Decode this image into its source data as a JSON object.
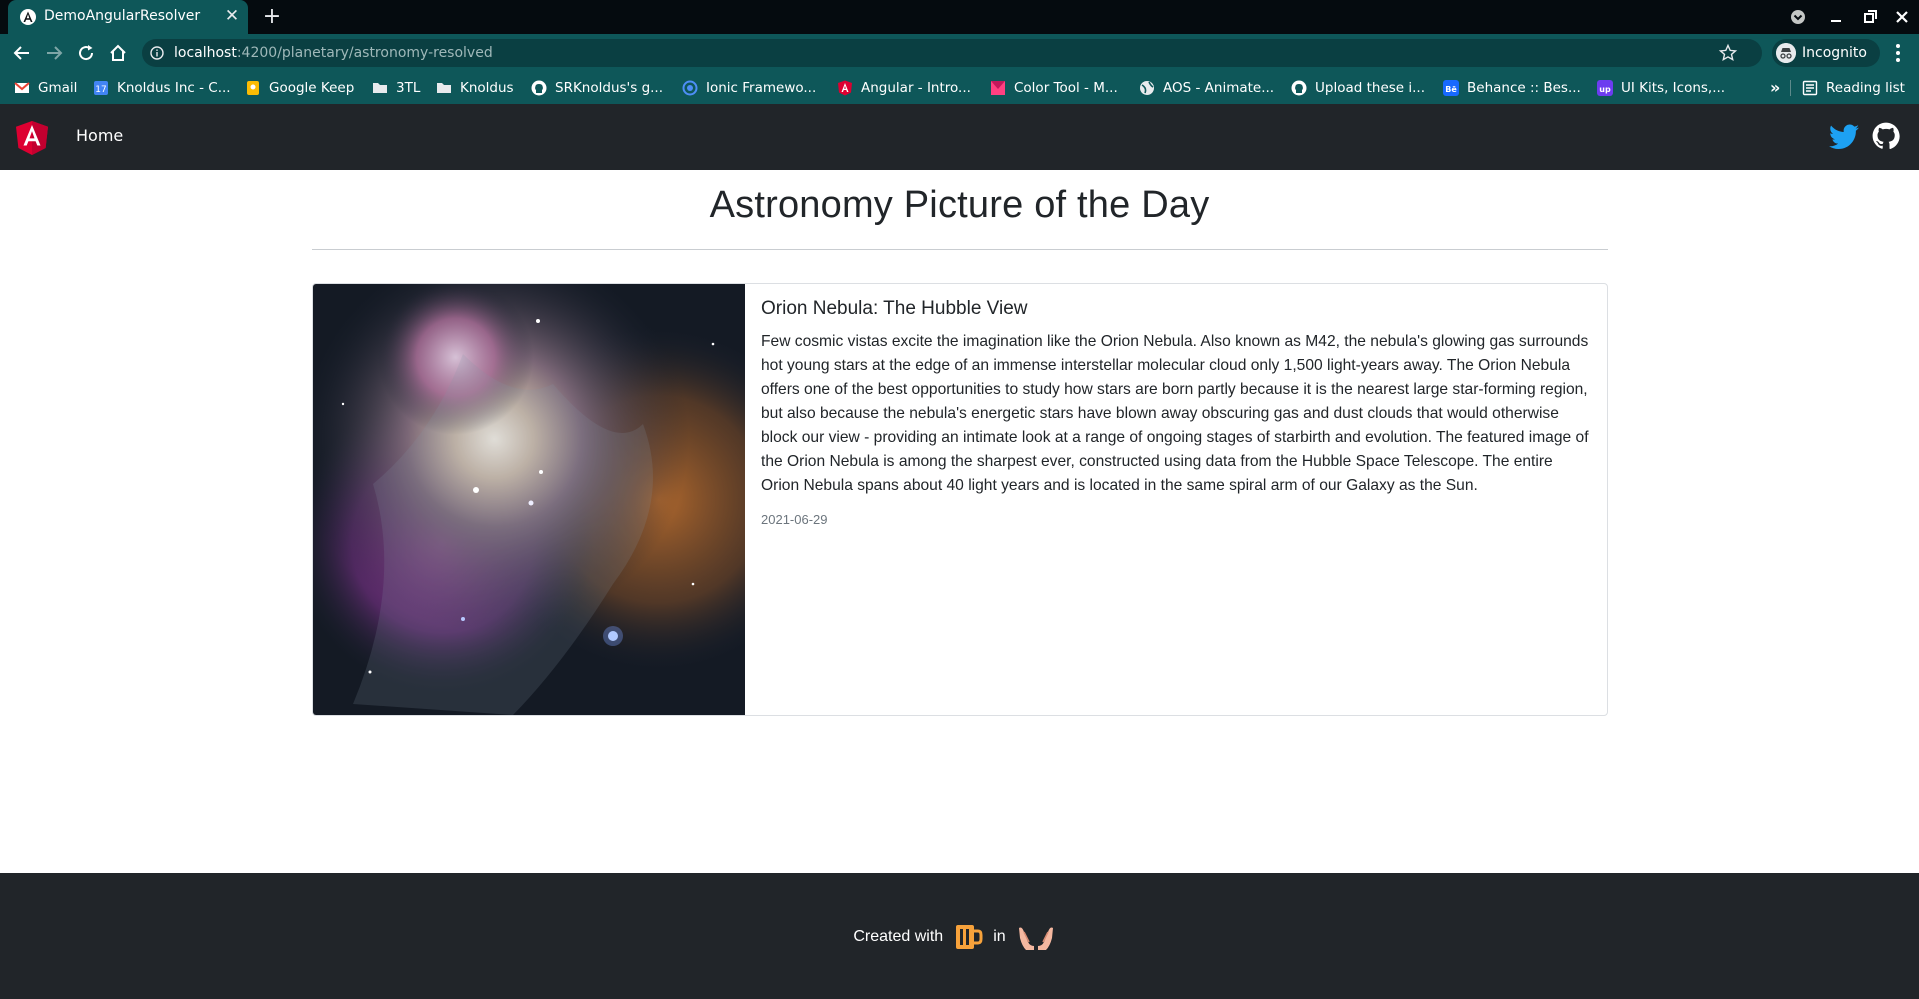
{
  "browser": {
    "tab_title": "DemoAngularResolver",
    "url_host": "localhost",
    "url_path": ":4200/planetary/astronomy-resolved",
    "profile_label": "Incognito",
    "bookmarks": [
      {
        "label": "Gmail",
        "icon": "gmail-icon"
      },
      {
        "label": "Knoldus Inc - C...",
        "icon": "calendar-icon"
      },
      {
        "label": "Google Keep",
        "icon": "keep-icon"
      },
      {
        "label": "3TL",
        "icon": "folder-icon"
      },
      {
        "label": "Knoldus",
        "icon": "folder-icon"
      },
      {
        "label": "SRKnoldus's g...",
        "icon": "github-icon"
      },
      {
        "label": "Ionic Framewo...",
        "icon": "ionic-icon"
      },
      {
        "label": "Angular - Intro...",
        "icon": "angular-icon"
      },
      {
        "label": "Color Tool - M...",
        "icon": "material-icon"
      },
      {
        "label": "AOS - Animate...",
        "icon": "globe-icon"
      },
      {
        "label": "Upload these i...",
        "icon": "github-icon"
      },
      {
        "label": "Behance :: Bes...",
        "icon": "behance-icon"
      },
      {
        "label": "UI Kits, Icons,...",
        "icon": "uplabs-icon"
      }
    ],
    "more_bookmarks": "»",
    "reading_list": "Reading list"
  },
  "navbar": {
    "home_label": "Home"
  },
  "main": {
    "title": "Astronomy Picture of the Day",
    "card": {
      "title": "Orion Nebula: The Hubble View",
      "explanation": "Few cosmic vistas excite the imagination like the Orion Nebula. Also known as M42, the nebula's glowing gas surrounds hot young stars at the edge of an immense interstellar molecular cloud only 1,500 light-years away. The Orion Nebula offers one of the best opportunities to study how stars are born partly because it is the nearest large star-forming region, but also because the nebula's energetic stars have blown away obscuring gas and dust clouds that would otherwise block our view - providing an intimate look at a range of ongoing stages of starbirth and evolution. The featured image of the Orion Nebula is among the sharpest ever, constructed using data from the Hubble Space Telescope. The entire Orion Nebula spans about 40 light years and is located in the same spiral arm of our Galaxy as the Sun.",
      "date": "2021-06-29"
    }
  },
  "footer": {
    "created_with": "Created with",
    "in_label": "in"
  },
  "colors": {
    "chrome_dark": "#050b0f",
    "chrome_teal": "#0e5759",
    "navbar": "#212529",
    "angular_red": "#dd0031",
    "twitter_blue": "#1da1f2"
  }
}
